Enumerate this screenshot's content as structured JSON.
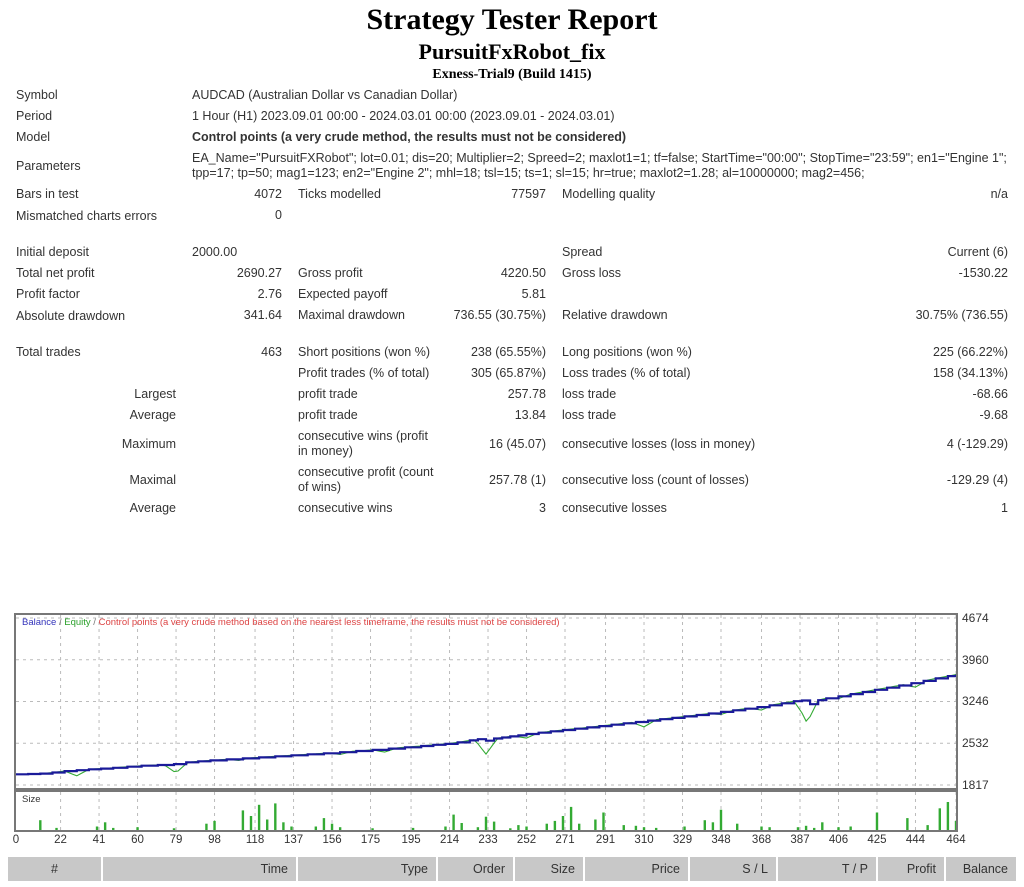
{
  "header": {
    "title": "Strategy Tester Report",
    "ea_name": "PursuitFxRobot_fix",
    "server": "Exness-Trial9 (Build 1415)"
  },
  "info": {
    "symbol_label": "Symbol",
    "symbol_value": "AUDCAD (Australian Dollar vs Canadian Dollar)",
    "period_label": "Period",
    "period_value": "1 Hour (H1) 2023.09.01 00:00 - 2024.03.01 00:00 (2023.09.01 - 2024.03.01)",
    "model_label": "Model",
    "model_value": "Control points (a very crude method, the results must not be considered)",
    "parameters_label": "Parameters",
    "parameters_value": "EA_Name=\"PursuitFXRobot\"; lot=0.01; dis=20; Multiplier=2; Spreed=2; maxlot1=1; tf=false; StartTime=\"00:00\"; StopTime=\"23:59\"; en1=\"Engine 1\"; tpp=17; tp=50; mag1=123; en2=\"Engine 2\"; mhl=18; tsl=15; ts=1; sl=15; hr=true; maxlot2=1.28; al=10000000; mag2=456;"
  },
  "stats": {
    "bars_in_test_label": "Bars in test",
    "bars_in_test_value": "4072",
    "ticks_modelled_label": "Ticks modelled",
    "ticks_modelled_value": "77597",
    "modelling_quality_label": "Modelling quality",
    "modelling_quality_value": "n/a",
    "mismatched_label": "Mismatched charts errors",
    "mismatched_value": "0",
    "initial_deposit_label": "Initial deposit",
    "initial_deposit_value": "2000.00",
    "spread_label": "Spread",
    "spread_value": "Current (6)",
    "total_net_profit_label": "Total net profit",
    "total_net_profit_value": "2690.27",
    "gross_profit_label": "Gross profit",
    "gross_profit_value": "4220.50",
    "gross_loss_label": "Gross loss",
    "gross_loss_value": "-1530.22",
    "profit_factor_label": "Profit factor",
    "profit_factor_value": "2.76",
    "expected_payoff_label": "Expected payoff",
    "expected_payoff_value": "5.81",
    "absolute_drawdown_label": "Absolute drawdown",
    "absolute_drawdown_value": "341.64",
    "maximal_drawdown_label": "Maximal drawdown",
    "maximal_drawdown_value": "736.55 (30.75%)",
    "relative_drawdown_label": "Relative drawdown",
    "relative_drawdown_value": "30.75% (736.55)",
    "total_trades_label": "Total trades",
    "total_trades_value": "463",
    "short_positions_label": "Short positions (won %)",
    "short_positions_value": "238 (65.55%)",
    "long_positions_label": "Long positions (won %)",
    "long_positions_value": "225 (66.22%)",
    "profit_trades_label": "Profit trades (% of total)",
    "profit_trades_value": "305 (65.87%)",
    "loss_trades_label": "Loss trades (% of total)",
    "loss_trades_value": "158 (34.13%)",
    "largest_label": "Largest",
    "largest_profit_trade_label": "profit trade",
    "largest_profit_trade_value": "257.78",
    "largest_loss_trade_label": "loss trade",
    "largest_loss_trade_value": "-68.66",
    "average_label": "Average",
    "average_profit_trade_label": "profit trade",
    "average_profit_trade_value": "13.84",
    "average_loss_trade_label": "loss trade",
    "average_loss_trade_value": "-9.68",
    "maximum_label": "Maximum",
    "max_consecutive_wins_label": "consecutive wins (profit in money)",
    "max_consecutive_wins_value": "16 (45.07)",
    "max_consecutive_losses_label": "consecutive losses (loss in money)",
    "max_consecutive_losses_value": "4 (-129.29)",
    "maximal_label": "Maximal",
    "maximal_consecutive_profit_label": "consecutive profit (count of wins)",
    "maximal_consecutive_profit_value": "257.78 (1)",
    "maximal_consecutive_loss_label": "consecutive loss (count of losses)",
    "maximal_consecutive_loss_value": "-129.29 (4)",
    "average2_label": "Average",
    "avg_consecutive_wins_label": "consecutive wins",
    "avg_consecutive_wins_value": "3",
    "avg_consecutive_losses_label": "consecutive losses",
    "avg_consecutive_losses_value": "1"
  },
  "chart_legend": {
    "balance": "Balance",
    "separator": " / ",
    "equity": "Equity",
    "control": "Control points (a very crude method based on the nearest less timeframe, the results must not be considered)",
    "size": "Size"
  },
  "trade_table": {
    "columns": [
      {
        "label": "#",
        "width": 95
      },
      {
        "label": "Time",
        "width": 195
      },
      {
        "label": "Type",
        "width": 140
      },
      {
        "label": "Order",
        "width": 77
      },
      {
        "label": "Size",
        "width": 70
      },
      {
        "label": "Price",
        "width": 105
      },
      {
        "label": "S / L",
        "width": 88
      },
      {
        "label": "T / P",
        "width": 100
      },
      {
        "label": "Profit",
        "width": 68
      },
      {
        "label": "Balance",
        "width": 70
      }
    ]
  },
  "colors": {
    "balance_line": "#1a1a99",
    "equity_line": "#33aa33",
    "model_red": "#cc2222",
    "panel_border": "#777777",
    "header_bg": "#c8c8c8"
  },
  "chart_data": {
    "type": "line",
    "title": "Balance / Equity / Control points",
    "xlabel": "",
    "ylabel": "",
    "grid": true,
    "legend_position": "top-left",
    "xlim": [
      0,
      464
    ],
    "ylim": [
      1817,
      4674
    ],
    "xticks": [
      0,
      22,
      41,
      60,
      79,
      98,
      118,
      137,
      156,
      175,
      195,
      214,
      233,
      252,
      271,
      291,
      310,
      329,
      348,
      368,
      387,
      406,
      425,
      444,
      464
    ],
    "yticks": [
      1817,
      2532,
      3246,
      3960,
      4674
    ],
    "series": [
      {
        "name": "Balance",
        "color": "#1a1a99",
        "x": [
          0,
          6,
          12,
          18,
          24,
          30,
          36,
          42,
          48,
          55,
          62,
          70,
          78,
          84,
          90,
          96,
          104,
          112,
          120,
          128,
          136,
          144,
          152,
          160,
          168,
          176,
          184,
          192,
          200,
          206,
          212,
          218,
          224,
          228,
          232,
          236,
          240,
          244,
          248,
          252,
          258,
          264,
          270,
          276,
          282,
          288,
          294,
          300,
          306,
          312,
          318,
          324,
          330,
          336,
          342,
          348,
          354,
          360,
          366,
          372,
          378,
          384,
          388,
          392,
          396,
          400,
          406,
          412,
          418,
          424,
          430,
          436,
          442,
          448,
          454,
          460,
          464
        ],
        "y": [
          2000,
          2005,
          2012,
          2030,
          2055,
          2070,
          2085,
          2098,
          2112,
          2130,
          2148,
          2160,
          2175,
          2205,
          2222,
          2238,
          2255,
          2272,
          2290,
          2308,
          2325,
          2342,
          2360,
          2378,
          2398,
          2418,
          2440,
          2462,
          2485,
          2505,
          2520,
          2545,
          2580,
          2600,
          2575,
          2612,
          2630,
          2648,
          2665,
          2690,
          2712,
          2735,
          2758,
          2780,
          2802,
          2825,
          2848,
          2872,
          2895,
          2918,
          2942,
          2965,
          2990,
          3015,
          3040,
          3068,
          3095,
          3122,
          3150,
          3180,
          3215,
          3250,
          3262,
          3200,
          3268,
          3300,
          3335,
          3372,
          3408,
          3445,
          3482,
          3520,
          3558,
          3598,
          3640,
          3680,
          3705
        ]
      },
      {
        "name": "Equity",
        "color": "#33aa33",
        "description": "Equity tracks balance closely with downward spikes at open-drawdown points",
        "spikes": [
          {
            "x": 30,
            "depth": 95
          },
          {
            "x": 79,
            "depth": 155
          },
          {
            "x": 110,
            "depth": 30
          },
          {
            "x": 160,
            "depth": 40
          },
          {
            "x": 182,
            "depth": 55
          },
          {
            "x": 232,
            "depth": 230
          },
          {
            "x": 252,
            "depth": 70
          },
          {
            "x": 310,
            "depth": 100
          },
          {
            "x": 348,
            "depth": 45
          },
          {
            "x": 368,
            "depth": 60
          },
          {
            "x": 390,
            "depth": 320
          },
          {
            "x": 406,
            "depth": 40
          },
          {
            "x": 444,
            "depth": 80
          }
        ]
      }
    ],
    "size_histogram": {
      "name": "Size",
      "color": "#33aa33",
      "x": [
        12,
        20,
        40,
        44,
        48,
        60,
        78,
        94,
        98,
        112,
        116,
        120,
        124,
        128,
        132,
        136,
        148,
        152,
        156,
        160,
        176,
        196,
        212,
        216,
        220,
        228,
        232,
        236,
        244,
        248,
        252,
        262,
        266,
        270,
        274,
        278,
        286,
        290,
        300,
        306,
        310,
        316,
        330,
        340,
        344,
        348,
        356,
        368,
        372,
        386,
        390,
        394,
        398,
        406,
        412,
        425,
        440,
        450,
        456,
        460,
        464
      ],
      "values": [
        28,
        6,
        10,
        22,
        6,
        8,
        5,
        18,
        26,
        56,
        40,
        72,
        30,
        76,
        22,
        10,
        10,
        34,
        18,
        8,
        5,
        6,
        10,
        44,
        20,
        8,
        38,
        24,
        5,
        14,
        10,
        18,
        26,
        40,
        66,
        18,
        30,
        50,
        14,
        12,
        8,
        6,
        10,
        28,
        22,
        58,
        18,
        10,
        8,
        8,
        12,
        6,
        22,
        8,
        10,
        50,
        34,
        14,
        62,
        80,
        26
      ]
    }
  }
}
